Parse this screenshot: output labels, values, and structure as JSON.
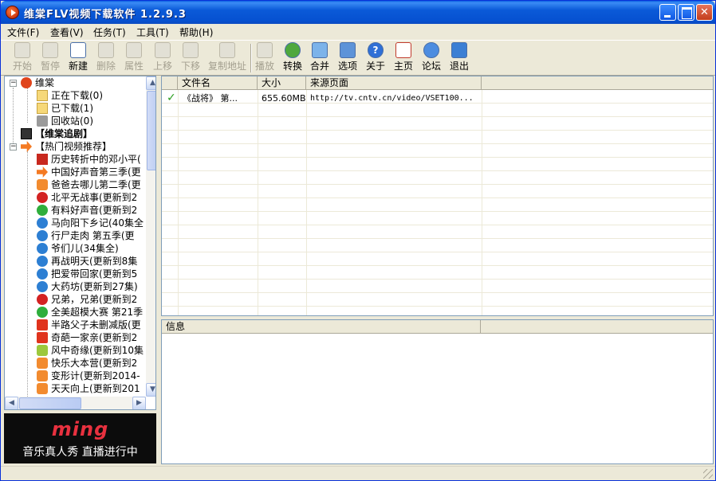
{
  "window": {
    "title": "维棠FLV视频下载软件 1.2.9.3"
  },
  "menu": [
    {
      "label": "文件(F)"
    },
    {
      "label": "查看(V)"
    },
    {
      "label": "任务(T)"
    },
    {
      "label": "工具(T)"
    },
    {
      "label": "帮助(H)"
    }
  ],
  "toolbar": [
    {
      "label": "开始",
      "icon": "play-icon",
      "enabled": false
    },
    {
      "label": "暂停",
      "icon": "pause-icon",
      "enabled": false
    },
    {
      "label": "新建",
      "icon": "new-document-icon",
      "enabled": true
    },
    {
      "label": "删除",
      "icon": "delete-icon",
      "enabled": false
    },
    {
      "label": "属性",
      "icon": "properties-icon",
      "enabled": false
    },
    {
      "label": "上移",
      "icon": "move-up-icon",
      "enabled": false
    },
    {
      "label": "下移",
      "icon": "move-down-icon",
      "enabled": false
    },
    {
      "label": "复制地址",
      "icon": "copy-address-icon",
      "enabled": false
    },
    {
      "label": "播放",
      "icon": "play-media-icon",
      "enabled": false
    },
    {
      "label": "转换",
      "icon": "convert-icon",
      "enabled": true
    },
    {
      "label": "合并",
      "icon": "merge-icon",
      "enabled": true
    },
    {
      "label": "选项",
      "icon": "options-icon",
      "enabled": true
    },
    {
      "label": "关于",
      "icon": "help-icon",
      "enabled": true
    },
    {
      "label": "主页",
      "icon": "home-page-icon",
      "enabled": true
    },
    {
      "label": "论坛",
      "icon": "forum-icon",
      "enabled": true
    },
    {
      "label": "退出",
      "icon": "exit-icon",
      "enabled": true
    }
  ],
  "tree": {
    "root": {
      "label": "维棠"
    },
    "downloads": [
      {
        "label": "正在下载(0)",
        "icon": "downloading-folder-icon"
      },
      {
        "label": "已下载(1)",
        "icon": "downloaded-folder-icon"
      },
      {
        "label": "回收站(0)",
        "icon": "recycle-bin-icon"
      }
    ],
    "section_drama": {
      "label": "【维棠追剧】"
    },
    "section_hot": {
      "label": "【热门视频推荐】"
    },
    "hot_items": [
      {
        "label": "历史转折中的邓小平(",
        "icon": "c-logo-icon"
      },
      {
        "label": "中国好声音第三季(更",
        "icon": "arrow-right-icon"
      },
      {
        "label": "爸爸去哪儿第二季(更",
        "icon": "tv-logo-icon"
      },
      {
        "label": "北平无战事(更新到2",
        "icon": "play-circle-icon"
      },
      {
        "label": "有料好声音(更新到2",
        "icon": "play-circle-icon"
      },
      {
        "label": "马向阳下乡记(40集全",
        "icon": "play-circle-icon"
      },
      {
        "label": "行尸走肉 第五季(更",
        "icon": "play-circle-icon"
      },
      {
        "label": "爷们儿(34集全)",
        "icon": "play-circle-icon"
      },
      {
        "label": "再战明天(更新到8集",
        "icon": "play-circle-icon"
      },
      {
        "label": "把爱带回家(更新到5",
        "icon": "play-circle-icon"
      },
      {
        "label": "大药坊(更新到27集)",
        "icon": "play-circle-icon"
      },
      {
        "label": "兄弟，兄弟(更新到2",
        "icon": "play-circle-icon"
      },
      {
        "label": "全美超模大赛 第21季",
        "icon": "play-circle-icon"
      },
      {
        "label": "半路父子未删减版(更",
        "icon": "le-logo-icon"
      },
      {
        "label": "奇葩一家亲(更新到2",
        "icon": "le-logo-icon"
      },
      {
        "label": "风中奇缘(更新到10集",
        "icon": "tv-logo-icon"
      },
      {
        "label": "快乐大本营(更新到2",
        "icon": "tv-logo-icon"
      },
      {
        "label": "变形计(更新到2014-",
        "icon": "tv-logo-icon"
      },
      {
        "label": "天天向上(更新到201",
        "icon": "tv-logo-icon"
      }
    ]
  },
  "ad": {
    "logo": "ming",
    "text": "音乐真人秀 直播进行中"
  },
  "list": {
    "columns": [
      "文件名",
      "大小",
      "来源页面"
    ],
    "rows": [
      {
        "status_icon": "check-icon",
        "name": "《战将》 第...",
        "size": "655.60MB",
        "source": "http://tv.cntv.cn/video/VSET100..."
      }
    ]
  },
  "info": {
    "header": "信息"
  },
  "colors": {
    "title_bar": "#0651d1",
    "check": "#2b9e1f",
    "chrome": "#ece9d8"
  }
}
